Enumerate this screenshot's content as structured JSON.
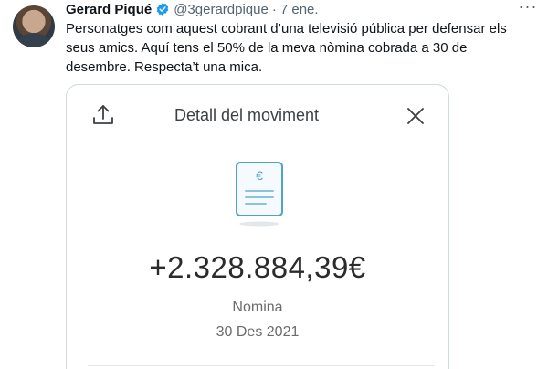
{
  "tweet": {
    "author_name": "Gerard Piqué",
    "handle": "@3gerardpique",
    "separator": "·",
    "date": "7 ene.",
    "text": "Personatges com aquest cobrant d’una televisió pública per defensar els\nseus amics. Aquí tens el 50% de la meva nòmina cobrada a 30 de\ndesembre. Respecta’t una mica.",
    "more_icon": "more-horizontal-icon",
    "verified_icon": "verified-badge-icon"
  },
  "media": {
    "title": "Detall del moviment",
    "amount": "+2.328.884,39€",
    "concept": "Nomina",
    "date": "30 Des 2021",
    "doc_symbol": "€",
    "icons": [
      "upload-icon",
      "close-icon",
      "receipt-document-icon"
    ]
  },
  "colors": {
    "verified": "#1d9bf0",
    "doc_accent": "#4fa3c6",
    "secondary_text": "#536471"
  }
}
